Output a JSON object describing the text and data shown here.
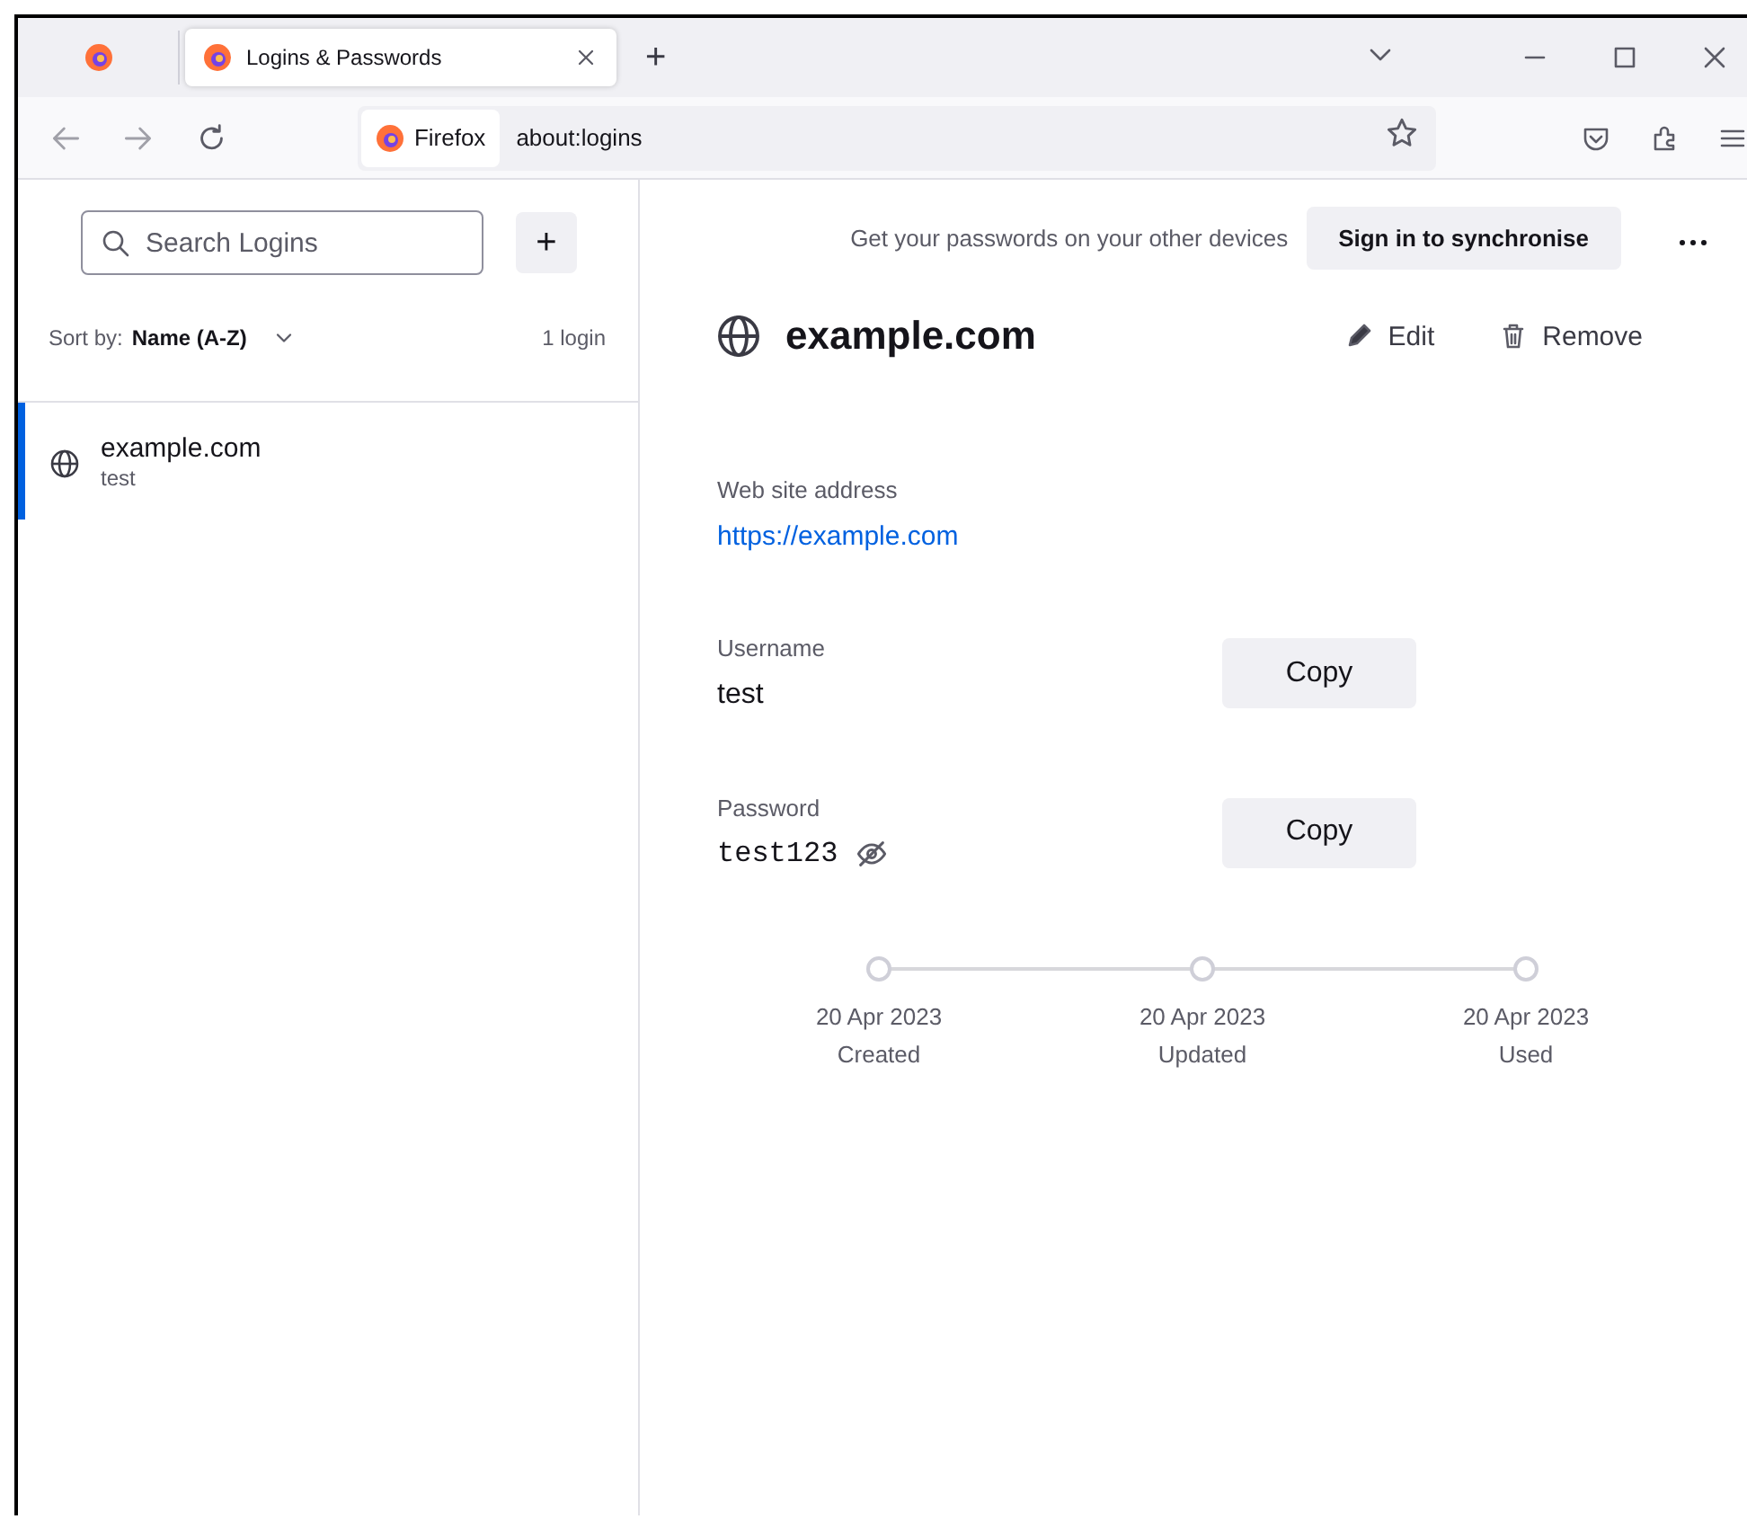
{
  "browser": {
    "tabs": [
      {
        "kind": "pinned",
        "selected": false
      },
      {
        "kind": "normal",
        "title": "Logins & Passwords",
        "selected": true
      }
    ],
    "new_tab": "+",
    "url": {
      "identity": "Firefox",
      "address": "about:logins"
    }
  },
  "sidebar": {
    "search": {
      "placeholder": "Search Logins"
    },
    "add": "+",
    "sort_label": "Sort by:",
    "sort_value": "Name (A-Z)",
    "count": "1 login",
    "logins": [
      {
        "title": "example.com",
        "username": "test",
        "selected": true
      }
    ]
  },
  "detail": {
    "sync_prompt": "Get your passwords on your other devices",
    "sync_button": "Sign in to synchronise",
    "title": "example.com",
    "edit": "Edit",
    "remove": "Remove",
    "fields": [
      {
        "kind": "link",
        "label": "Web site address",
        "value": "https://example.com"
      },
      {
        "kind": "text",
        "label": "Username",
        "value": "test",
        "copy": "Copy"
      },
      {
        "kind": "password",
        "label": "Password",
        "value": "test123",
        "copy": "Copy"
      }
    ],
    "timeline": [
      {
        "date": "20 Apr 2023",
        "label": "Created"
      },
      {
        "date": "20 Apr 2023",
        "label": "Updated"
      },
      {
        "date": "20 Apr 2023",
        "label": "Used"
      }
    ]
  }
}
